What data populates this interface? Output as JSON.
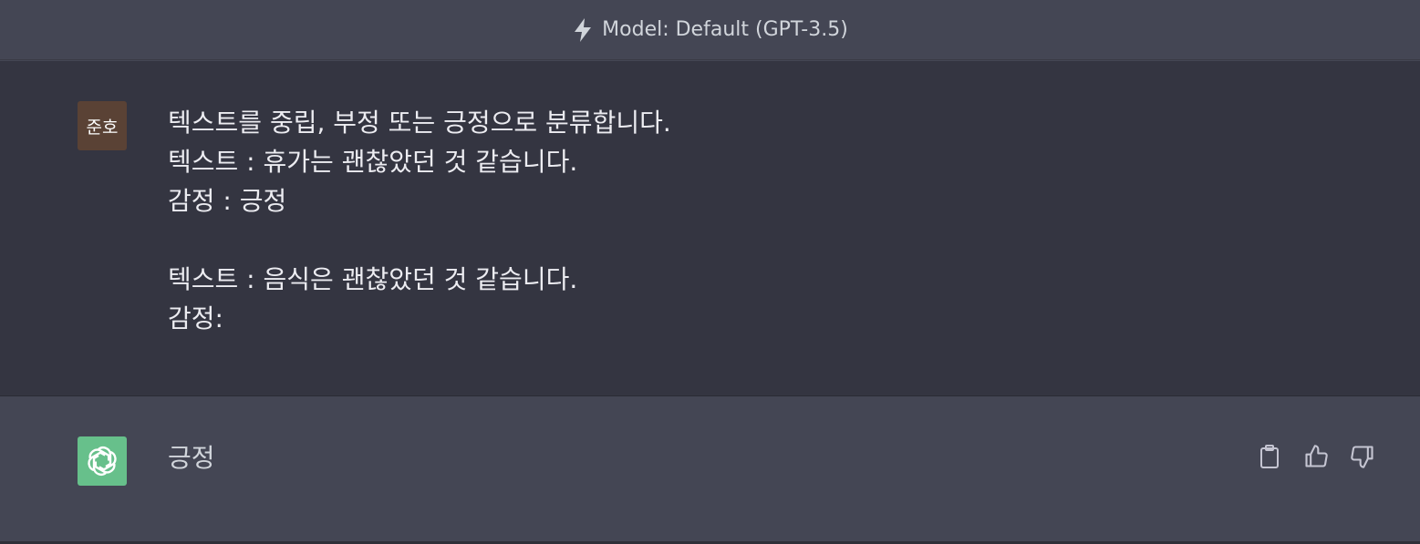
{
  "header": {
    "model_label": "Model: Default (GPT-3.5)",
    "icon": "lightning-bolt-icon"
  },
  "user_message": {
    "avatar_text": "준호",
    "text": "텍스트를 중립, 부정 또는 긍정으로 분류합니다.\n텍스트 : 휴가는 괜찮았던 것 같습니다.\n감정 : 긍정\n\n텍스트 : 음식은 괜찮았던 것 같습니다.\n감정:"
  },
  "assistant_message": {
    "avatar_icon": "openai-logo-icon",
    "text": "긍정",
    "actions": [
      "copy-icon",
      "thumbs-up-icon",
      "thumbs-down-icon"
    ]
  },
  "colors": {
    "header_bg": "#444654",
    "user_bg": "#343541",
    "assistant_bg": "#444654",
    "user_avatar_bg": "#5a4235",
    "bot_avatar_bg": "#67c08b"
  }
}
